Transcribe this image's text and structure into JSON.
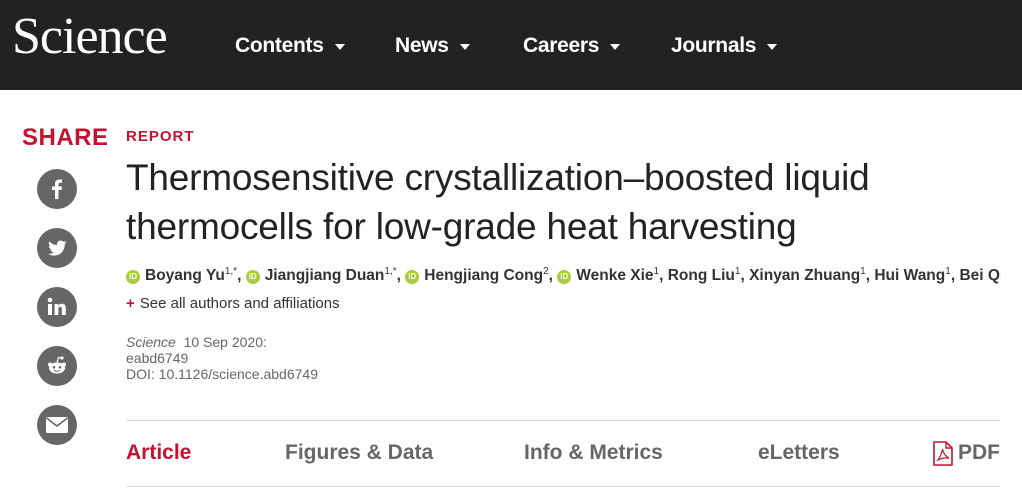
{
  "header": {
    "logo": "Science",
    "nav": [
      "Contents",
      "News",
      "Careers",
      "Journals"
    ]
  },
  "share": {
    "label": "SHARE",
    "buttons": [
      "facebook-icon",
      "twitter-icon",
      "linkedin-icon",
      "reddit-icon",
      "email-icon"
    ]
  },
  "article": {
    "type": "REPORT",
    "title": "Thermosensitive crystallization–boosted liquid thermocells for low-grade heat harvesting",
    "authors": [
      {
        "name": "Boyang Yu",
        "sup": "1,*",
        "orcid": true
      },
      {
        "name": "Jiangjiang Duan",
        "sup": "1,*",
        "orcid": true
      },
      {
        "name": "Hengjiang Cong",
        "sup": "2",
        "orcid": true
      },
      {
        "name": "Wenke Xie",
        "sup": "1",
        "orcid": true
      },
      {
        "name": "Rong Liu",
        "sup": "1",
        "orcid": false
      },
      {
        "name": "Xinyan Zhuang",
        "sup": "1",
        "orcid": false
      },
      {
        "name": "Hui Wang",
        "sup": "1",
        "orcid": false
      },
      {
        "name": "Bei Qi...",
        "sup": "",
        "orcid": false
      }
    ],
    "see_all": "See all authors and affiliations",
    "journal": "Science",
    "date": "10 Sep 2020:",
    "id": "eabd6749",
    "doi": "DOI: 10.1126/science.abd6749"
  },
  "tabs": {
    "items": [
      "Article",
      "Figures & Data",
      "Info & Metrics",
      "eLetters",
      "PDF"
    ],
    "active": "Article"
  },
  "colors": {
    "accent": "#c4122f",
    "header_bg": "#222222",
    "orcid": "#a6ce39",
    "share_bg": "#666666"
  }
}
